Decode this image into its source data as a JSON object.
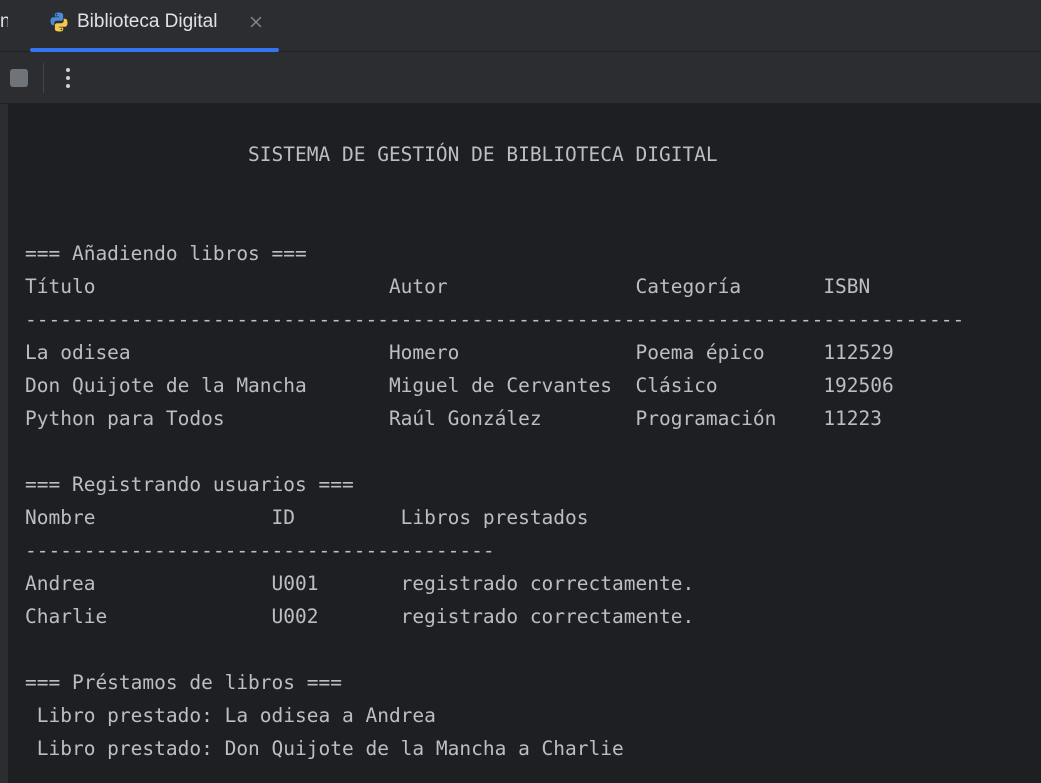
{
  "tabs": {
    "previous_fragment": "n",
    "active_title": "Biblioteca Digital",
    "active_icon": "python-file-icon",
    "close_icon": "close-icon"
  },
  "toolbar": {
    "stop_icon": "stop-icon",
    "more_icon": "more-vertical-icon"
  },
  "colors": {
    "accent": "#3574f0",
    "background": "#1e1f22",
    "panel": "#2b2d30",
    "text": "#bcbec4"
  },
  "console": {
    "lines": [
      "                   SISTEMA DE GESTIÓN DE BIBLIOTECA DIGITAL",
      "",
      "",
      "=== Añadiendo libros ===",
      "Título                         Autor                Categoría       ISBN",
      "--------------------------------------------------------------------------------",
      "La odisea                      Homero               Poema épico     112529",
      "Don Quijote de la Mancha       Miguel de Cervantes  Clásico         192506",
      "Python para Todos              Raúl González        Programación    11223",
      "",
      "=== Registrando usuarios ===",
      "Nombre               ID         Libros prestados",
      "----------------------------------------",
      "Andrea               U001       registrado correctamente.",
      "Charlie              U002       registrado correctamente.",
      "",
      "=== Préstamos de libros ===",
      " Libro prestado: La odisea a Andrea",
      " Libro prestado: Don Quijote de la Mancha a Charlie"
    ]
  }
}
